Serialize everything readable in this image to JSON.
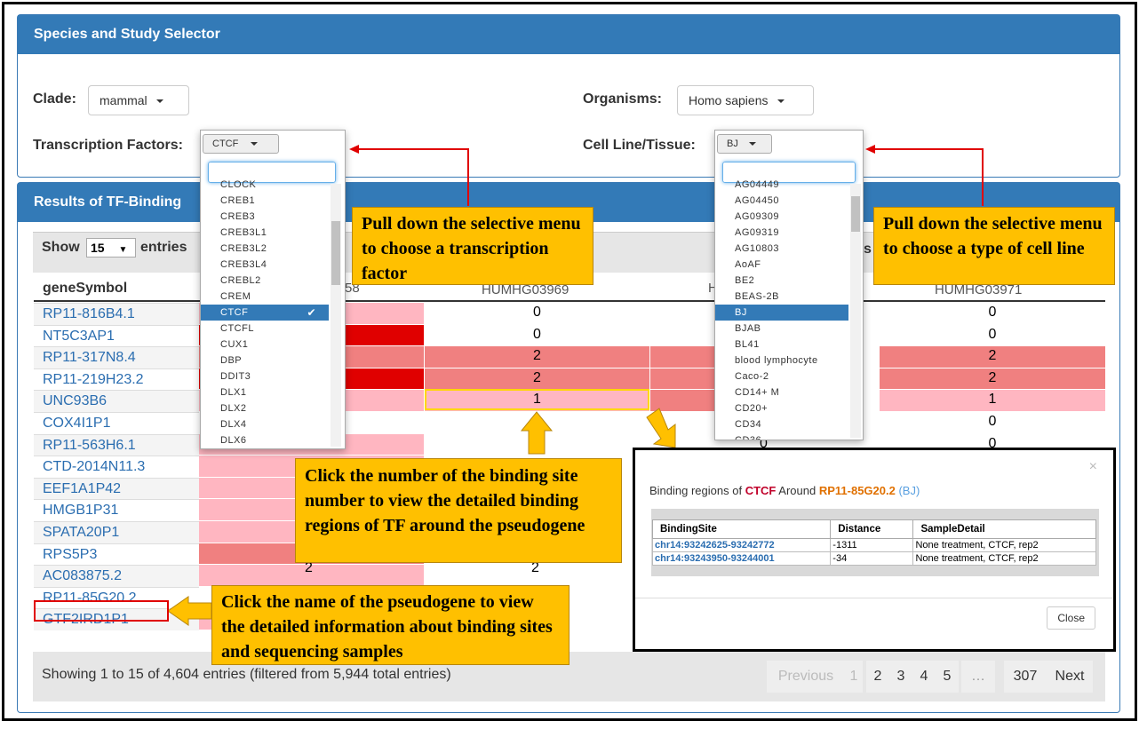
{
  "selector": {
    "title": "Species and Study Selector",
    "clade_label": "Clade:",
    "clade_value": "mammal",
    "organism_label": "Organisms:",
    "organism_value": "Homo sapiens",
    "tf_label": "Transcription Factors:",
    "tf_value": "CTCF",
    "cell_label": "Cell Line/Tissue:",
    "cell_value": "BJ"
  },
  "tf_dropdown": {
    "items": [
      "CLOCK",
      "CREB1",
      "CREB3",
      "CREB3L1",
      "CREB3L2",
      "CREB3L4",
      "CREBL2",
      "CREM",
      "CTCF",
      "CTCFL",
      "CUX1",
      "DBP",
      "DDIT3",
      "DLX1",
      "DLX2",
      "DLX4",
      "DLX6"
    ],
    "selected": "CTCF"
  },
  "cell_dropdown": {
    "items": [
      "AG04449",
      "AG04450",
      "AG09309",
      "AG09319",
      "AG10803",
      "AoAF",
      "BE2",
      "BEAS-2B",
      "BJ",
      "BJAB",
      "BL41",
      "blood lymphocyte",
      "Caco-2",
      "CD14+ M",
      "CD20+",
      "CD34",
      "CD36"
    ],
    "selected": "BJ"
  },
  "results": {
    "title": "Results of TF-Binding",
    "show_label": "Show",
    "show_value": "15",
    "entries_label": "entries",
    "entries_partial": "s",
    "col_gene": "geneSymbol",
    "col_a_partial": "58",
    "col_b": "HUMHG03969",
    "col_c_partial": "H",
    "col_d": "HUMHG03971",
    "genes": [
      "RP11-816B4.1",
      "NT5C3AP1",
      "RP11-317N8.4",
      "RP11-219H23.2",
      "UNC93B6",
      "COX4I1P1",
      "RP11-563H6.1",
      "CTD-2014N11.3",
      "EEF1A1P42",
      "HMGB1P31",
      "SPATA20P1",
      "RPS5P3",
      "AC083875.2",
      "RP11-85G20.2",
      "GTF2IRD1P1"
    ],
    "col_b_values": [
      "0",
      "0",
      "2",
      "2",
      "1"
    ],
    "col_d_values": [
      "0",
      "0",
      "2",
      "2",
      "1",
      "0",
      "0"
    ],
    "partial_values": [
      "2",
      "2",
      "0"
    ],
    "footer_info": "Showing 1 to 15 of 4,604 entries (filtered from 5,944 total entries)",
    "pagination": [
      "Previous",
      "1",
      "2",
      "3",
      "4",
      "5",
      "…",
      "307",
      "Next"
    ]
  },
  "modal": {
    "heading_prefix": "Binding regions of",
    "heading_tf": "CTCF",
    "heading_mid": "Around",
    "heading_gene": "RP11-85G20.2",
    "heading_cell": "(BJ)",
    "close_x": "×",
    "columns": [
      "BindingSite",
      "Distance",
      "SampleDetail"
    ],
    "rows": [
      [
        "chr14:93242625-93242772",
        "-1311",
        "None treatment, CTCF, rep2"
      ],
      [
        "chr14:93243950-93244001",
        "-34",
        "None treatment, CTCF, rep2"
      ]
    ],
    "close_button": "Close"
  },
  "callouts": {
    "tf": "Pull down the selective menu to choose a transcription factor",
    "cell": "Pull down the selective menu to choose a type of cell line",
    "number": "Click the number of the binding site number to view the detailed binding regions of TF around the pseudogene",
    "name": "Click the name of the pseudogene to view the detailed information about binding sites and sequencing samples"
  },
  "colors": {
    "header": "#337ab7",
    "heat_light": "#ffb6c1",
    "heat_mid": "#f08080",
    "heat_dark": "#e00000",
    "callout": "#ffc000"
  }
}
